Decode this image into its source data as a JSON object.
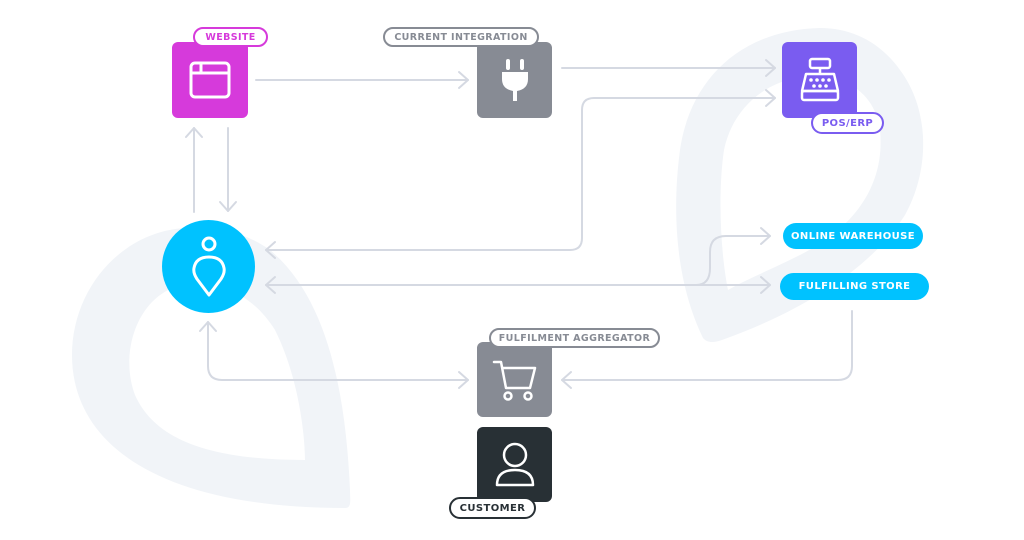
{
  "diagram": {
    "colors": {
      "website": "#D63ADB",
      "integration": "#878B94",
      "pos_erp": "#7A5CF0",
      "hub": "#00C2FF",
      "aggregator": "#878B94",
      "customer": "#283035",
      "connector": "#D5D9E2",
      "watermark": "#F1F4F8"
    },
    "nodes": {
      "website": {
        "label": "WEBSITE",
        "icon": "browser-window-icon"
      },
      "current_integration": {
        "label": "CURRENT INTEGRATION",
        "icon": "plug-icon"
      },
      "pos_erp": {
        "label": "POS/ERP",
        "icon": "cash-register-icon"
      },
      "hub": {
        "label": "",
        "icon": "location-pin-person-icon"
      },
      "online_warehouse": {
        "label": "ONLINE WAREHOUSE"
      },
      "fulfilling_store": {
        "label": "FULFILLING STORE"
      },
      "fulfilment_aggregator": {
        "label": "FULFILMENT AGGREGATOR",
        "icon": "shopping-cart-icon"
      },
      "customer": {
        "label": "CUSTOMER",
        "icon": "user-icon"
      }
    },
    "connections": [
      {
        "from": "website",
        "to": "current_integration"
      },
      {
        "from": "current_integration",
        "to": "pos_erp"
      },
      {
        "from": "hub",
        "to": "website"
      },
      {
        "from": "website",
        "to": "hub"
      },
      {
        "from": "pos_erp",
        "to": "hub"
      },
      {
        "from": "hub",
        "to": "pos_erp"
      },
      {
        "from": "hub",
        "to": "online_warehouse"
      },
      {
        "from": "hub",
        "to": "fulfilling_store"
      },
      {
        "from": "fulfilling_store",
        "to": "hub"
      },
      {
        "from": "hub",
        "to": "fulfilment_aggregator"
      },
      {
        "from": "fulfilment_aggregator",
        "to": "hub"
      },
      {
        "from": "fulfilling_store",
        "to": "fulfilment_aggregator"
      }
    ]
  }
}
